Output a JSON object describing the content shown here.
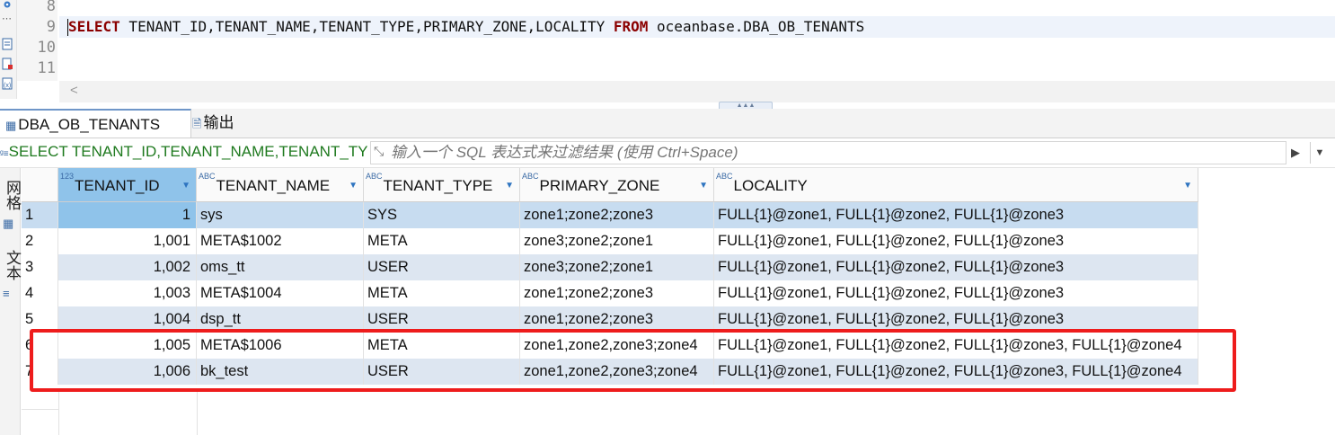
{
  "editor": {
    "line_numbers": [
      "8",
      "9",
      "10",
      "11"
    ],
    "query": {
      "select_kw": "SELECT",
      "columns": " TENANT_ID,TENANT_NAME,TENANT_TYPE,PRIMARY_ZONE,LOCALITY ",
      "from_kw": "FROM",
      "table": " oceanbase.DBA_OB_TENANTS"
    },
    "scroll_left": "<"
  },
  "tabs": [
    {
      "label": "DBA_OB_TENANTS 1",
      "close": "×"
    },
    {
      "label": "输出"
    }
  ],
  "filter": {
    "sql_preview": "SELECT TENANT_ID,TENANT_NAME,TENANT_TYPE,PRIMARY_ZONE,LOCALITY FROM",
    "placeholder": "输入一个 SQL 表达式来过滤结果 (使用 Ctrl+Space)"
  },
  "side_panel": {
    "grid_label": "网格",
    "text_label": "文本"
  },
  "grid": {
    "columns": [
      {
        "type": "123",
        "name": "TENANT_ID"
      },
      {
        "type": "ABC",
        "name": "TENANT_NAME"
      },
      {
        "type": "ABC",
        "name": "TENANT_TYPE"
      },
      {
        "type": "ABC",
        "name": "PRIMARY_ZONE"
      },
      {
        "type": "ABC",
        "name": "LOCALITY"
      }
    ],
    "rows": [
      {
        "n": "1",
        "id": "1",
        "name": "sys",
        "type": "SYS",
        "zone": "zone1;zone2;zone3",
        "locality": "FULL{1}@zone1, FULL{1}@zone2, FULL{1}@zone3"
      },
      {
        "n": "2",
        "id": "1,001",
        "name": "META$1002",
        "type": "META",
        "zone": "zone3;zone2;zone1",
        "locality": "FULL{1}@zone1, FULL{1}@zone2, FULL{1}@zone3"
      },
      {
        "n": "3",
        "id": "1,002",
        "name": "oms_tt",
        "type": "USER",
        "zone": "zone3;zone2;zone1",
        "locality": "FULL{1}@zone1, FULL{1}@zone2, FULL{1}@zone3"
      },
      {
        "n": "4",
        "id": "1,003",
        "name": "META$1004",
        "type": "META",
        "zone": "zone1;zone2;zone3",
        "locality": "FULL{1}@zone1, FULL{1}@zone2, FULL{1}@zone3"
      },
      {
        "n": "5",
        "id": "1,004",
        "name": "dsp_tt",
        "type": "USER",
        "zone": "zone1;zone2;zone3",
        "locality": "FULL{1}@zone1, FULL{1}@zone2, FULL{1}@zone3"
      },
      {
        "n": "6",
        "id": "1,005",
        "name": "META$1006",
        "type": "META",
        "zone": "zone1,zone2,zone3;zone4",
        "locality": "FULL{1}@zone1, FULL{1}@zone2, FULL{1}@zone3, FULL{1}@zone4"
      },
      {
        "n": "7",
        "id": "1,006",
        "name": "bk_test",
        "type": "USER",
        "zone": "zone1,zone2,zone3;zone4",
        "locality": "FULL{1}@zone1, FULL{1}@zone2, FULL{1}@zone3, FULL{1}@zone4"
      }
    ]
  },
  "colors": {
    "keyword": "#8b0000",
    "selected_cell": "#8fc3ea",
    "alt_row": "#dde6f1",
    "selected_row": "#c7dcf0",
    "annotation": "#ee1c1c",
    "sql_preview": "#1f7a1f"
  }
}
